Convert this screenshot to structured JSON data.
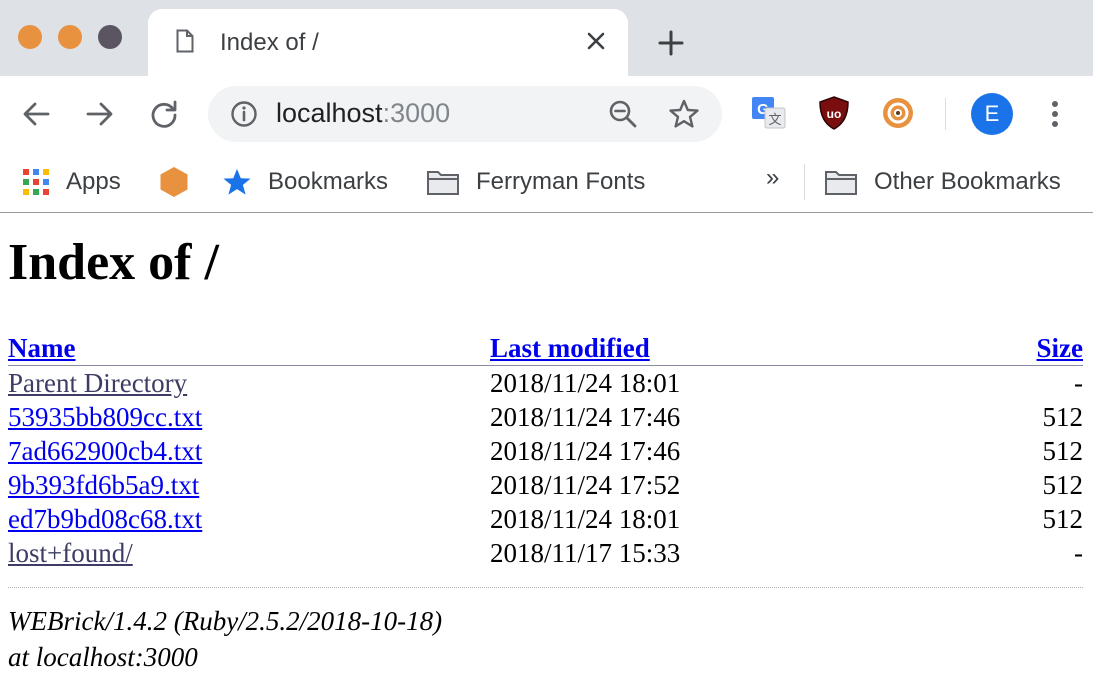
{
  "browser": {
    "tab": {
      "title": "Index of /"
    },
    "address": {
      "host": "localhost",
      "port": ":3000"
    },
    "profile_initial": "E",
    "bookmarks": [
      {
        "label": "Apps"
      },
      {
        "label": ""
      },
      {
        "label": "Bookmarks"
      },
      {
        "label": "Ferryman Fonts"
      }
    ],
    "more_label": "»",
    "other_bookmarks": "Other Bookmarks",
    "colors": {
      "accent": "#1a73e8",
      "traffic": "#e8923f",
      "tabstrip": "#dee1e6"
    }
  },
  "page": {
    "heading": "Index of /",
    "columns": {
      "name": "Name",
      "modified": "Last modified",
      "size": "Size"
    },
    "rows": [
      {
        "name": "Parent Directory",
        "modified": "2018/11/24 18:01",
        "size": "-"
      },
      {
        "name": "53935bb809cc.txt",
        "modified": "2018/11/24 17:46",
        "size": "512"
      },
      {
        "name": "7ad662900cb4.txt",
        "modified": "2018/11/24 17:46",
        "size": "512"
      },
      {
        "name": "9b393fd6b5a9.txt",
        "modified": "2018/11/24 17:52",
        "size": "512"
      },
      {
        "name": "ed7b9bd08c68.txt",
        "modified": "2018/11/24 18:01",
        "size": "512"
      },
      {
        "name": "lost+found/",
        "modified": "2018/11/17 15:33",
        "size": "-"
      }
    ],
    "footer": {
      "server": "WEBrick/1.4.2 (Ruby/2.5.2/2018-10-18)",
      "host": "at localhost:3000"
    }
  }
}
